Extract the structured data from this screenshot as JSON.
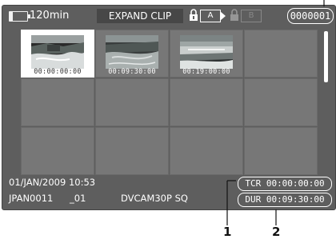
{
  "header": {
    "battery_icon": "battery-icon",
    "time_remaining": "120min",
    "title": "EXPAND CLIP",
    "slot_a_label": "A",
    "slot_b_label": "B",
    "lock_icon": "lock-icon",
    "counter": "0000001"
  },
  "thumbnails": [
    {
      "timecode": "00:00:00:00",
      "selected": true,
      "has_image": true
    },
    {
      "timecode": "00:09:30:00",
      "selected": false,
      "has_image": true
    },
    {
      "timecode": "00:19:00:00",
      "selected": false,
      "has_image": true
    }
  ],
  "info": {
    "datetime": "01/JAN/2009 10:53",
    "clip_name": "JPAN0011",
    "clip_suffix": "_01",
    "format": "DVCAM30P SQ",
    "tcr": "TCR 00:00:00:00",
    "dur": "DUR 00:09:30:00"
  },
  "callouts": {
    "one": "1",
    "two": "2"
  },
  "colors": {
    "screen_bg": "#5e5e5e",
    "cell_bg": "#777777",
    "selected_bg": "#ffffff"
  }
}
